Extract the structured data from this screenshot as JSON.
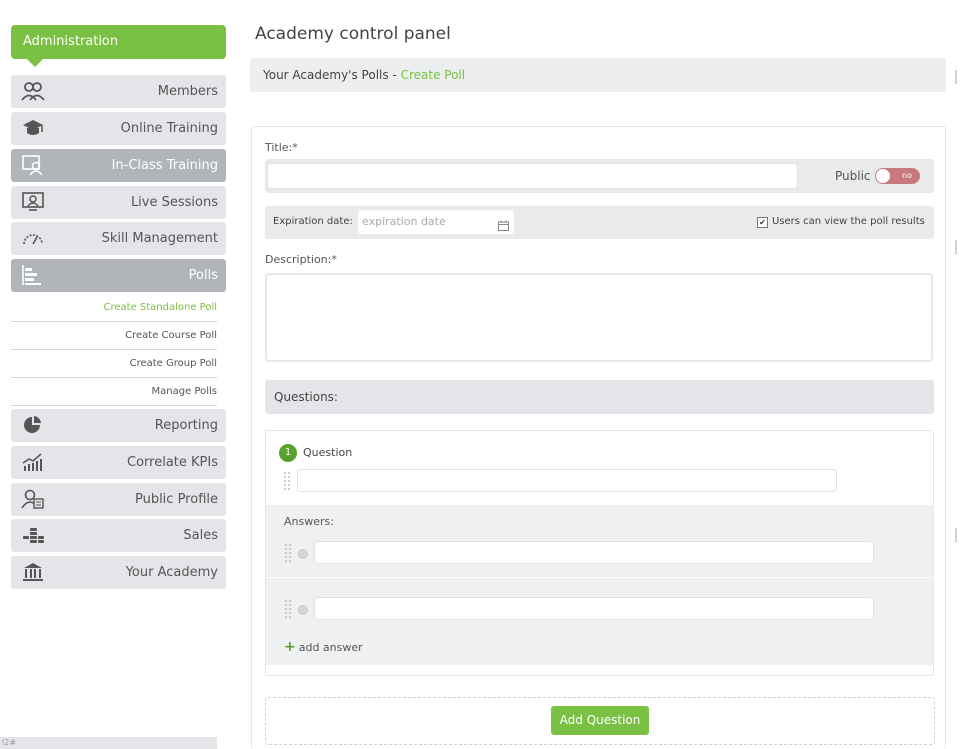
{
  "sidebar": {
    "header": "Administration",
    "items": [
      {
        "label": "Members",
        "icon": "members-icon",
        "active": false
      },
      {
        "label": "Online Training",
        "icon": "graduation-cap-icon",
        "active": false
      },
      {
        "label": "In-Class Training",
        "icon": "classroom-icon",
        "active": true
      },
      {
        "label": "Live Sessions",
        "icon": "webcam-presenter-icon",
        "active": false
      },
      {
        "label": "Skill Management",
        "icon": "gauge-icon",
        "active": false
      },
      {
        "label": "Polls",
        "icon": "poll-bars-icon",
        "active": true
      }
    ],
    "subitems": [
      {
        "label": "Create Standalone Poll",
        "active": true
      },
      {
        "label": "Create Course Poll",
        "active": false
      },
      {
        "label": "Create Group Poll",
        "active": false
      },
      {
        "label": "Manage Polls",
        "active": false
      }
    ],
    "items2": [
      {
        "label": "Reporting",
        "icon": "pie-chart-icon"
      },
      {
        "label": "Correlate KPIs",
        "icon": "trend-chart-icon"
      },
      {
        "label": "Public Profile",
        "icon": "profile-card-icon"
      },
      {
        "label": "Sales",
        "icon": "coins-icon"
      },
      {
        "label": "Your Academy",
        "icon": "institution-icon"
      }
    ],
    "footer": "l2#"
  },
  "main": {
    "title": "Academy control panel",
    "breadcrumb": {
      "prefix": "Your Academy's Polls - ",
      "link": "Create Poll"
    },
    "form": {
      "title_label": "Title:*",
      "title_value": "",
      "public_label": "Public",
      "public_toggle": "no",
      "expiration_label": "Expiration date:",
      "expiration_placeholder": "expiration date",
      "view_results_label": "Users can view the poll results",
      "view_results_checked": true,
      "description_label": "Description:*",
      "questions_label": "Questions:",
      "question": {
        "number": "1",
        "label": "Question",
        "value": ""
      },
      "answers_label": "Answers:",
      "answers": [
        "",
        ""
      ],
      "add_answer_label": "add answer",
      "add_question_label": "Add Question"
    }
  },
  "colors": {
    "accent": "#7ac043",
    "active_nav": "#b1b5ba",
    "toggle_off": "#c9787c"
  }
}
